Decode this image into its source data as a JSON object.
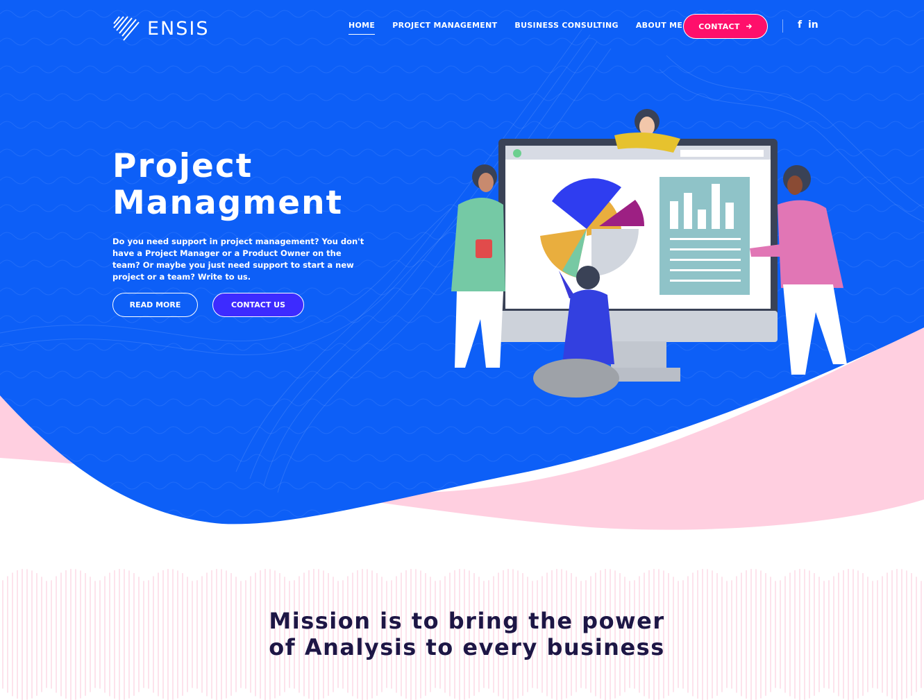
{
  "brand": {
    "name": "ENSIS",
    "logo_icon": "stripes-logo-icon"
  },
  "nav": {
    "items": [
      {
        "label": "HOME",
        "active": true
      },
      {
        "label": "PROJECT MANAGEMENT",
        "active": false
      },
      {
        "label": "BUSINESS CONSULTING",
        "active": false
      },
      {
        "label": "ABOUT ME",
        "active": false
      }
    ],
    "contact_label": "CONTACT",
    "contact_icon": "arrow-right-icon"
  },
  "social": {
    "facebook": "f",
    "linkedin": "in"
  },
  "hero": {
    "title_line1": "Project",
    "title_line2": "Managment",
    "description": "Do you need support in project management? You don't have a Project Manager or a Product Owner on the team? Or maybe you just need support to start a new project or a team? Write to us.",
    "read_more_label": "READ MORE",
    "contact_us_label": "CONTACT US"
  },
  "mission": {
    "line1": "Mission is to bring the power",
    "line2": "of Analysis to every business"
  },
  "colors": {
    "hero_blue": "#0d5ff7",
    "accent_pink": "#ff0f6b",
    "wave_pink": "#ffcfe0",
    "button_purple": "#3d2bff",
    "mission_text": "#1d1645"
  }
}
